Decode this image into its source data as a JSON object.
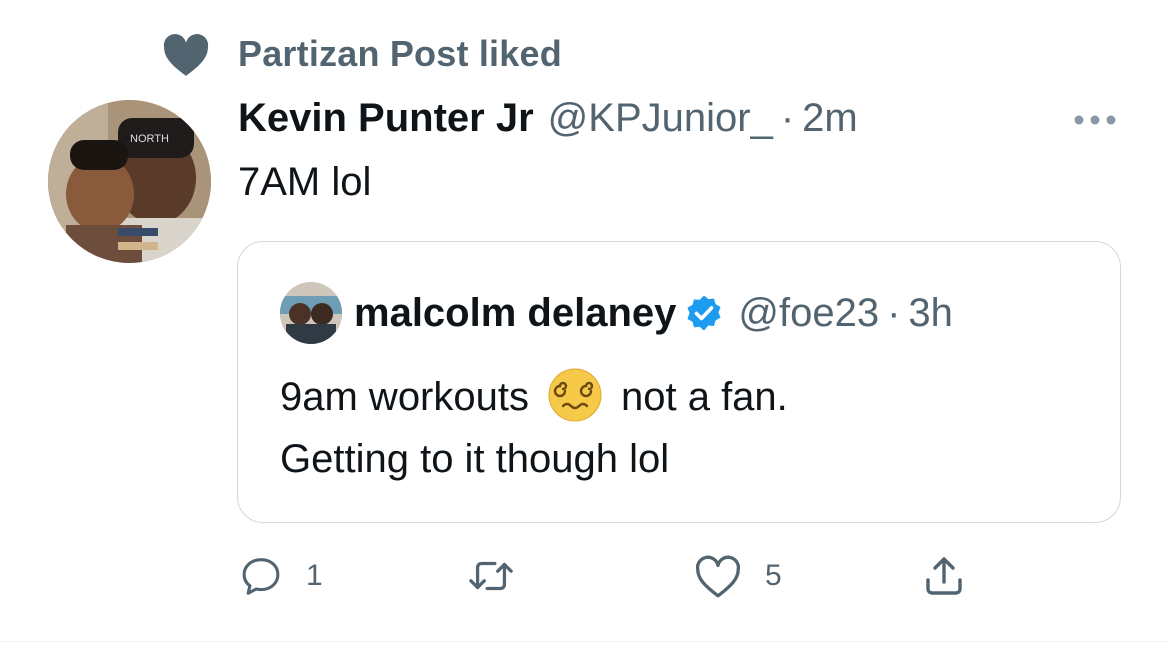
{
  "social_context": {
    "text": "Partizan Post liked",
    "icon": "heart-filled-icon"
  },
  "tweet": {
    "author_name": "Kevin Punter Jr",
    "author_handle": "@KPJunior_",
    "separator": "·",
    "time": "2m",
    "text": "7AM lol"
  },
  "quoted_tweet": {
    "author_name": "malcolm delaney",
    "verified": true,
    "author_handle": "@foe23",
    "separator": "·",
    "time": "3h",
    "text_before_emoji": "9am workouts",
    "emoji": "dizzy-face-emoji",
    "text_after_emoji": "not a fan.",
    "text_line2": "Getting to it though lol"
  },
  "actions": {
    "reply_count": "1",
    "retweet_count": "",
    "like_count": "5"
  },
  "colors": {
    "primary_text": "#0f1419",
    "secondary_text": "#536471",
    "border": "#cfd9de",
    "verified_blue": "#1d9bf0"
  }
}
